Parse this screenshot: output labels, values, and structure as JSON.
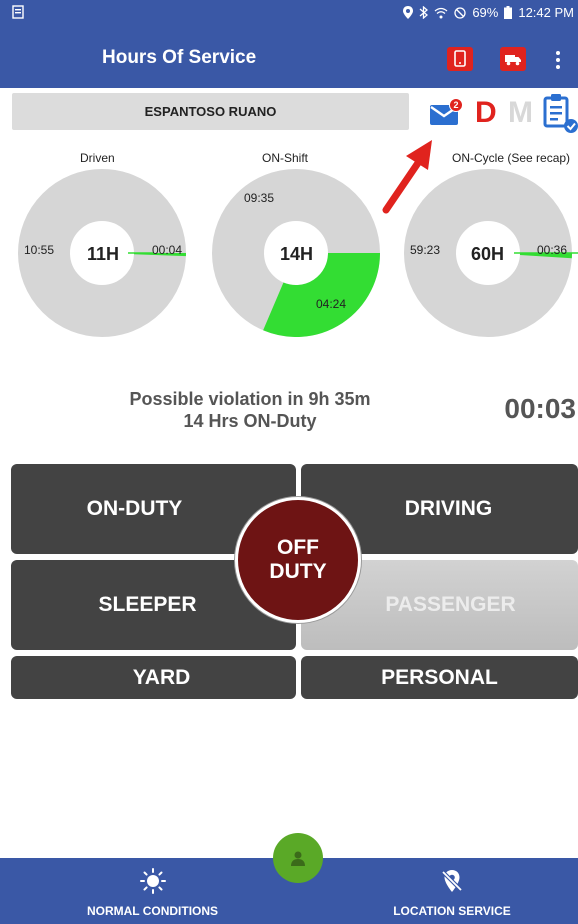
{
  "status_bar": {
    "battery": "69%",
    "time": "12:42 PM"
  },
  "app_bar": {
    "title": "Hours Of Service",
    "icons": [
      "phone-icon",
      "truck-icon",
      "more-vert-icon"
    ]
  },
  "driver": {
    "name": "ESPANTOSO RUANO",
    "mail_badge": "2",
    "letter_d": "D",
    "letter_m": "M"
  },
  "gauges": {
    "driven": {
      "label": "Driven",
      "center": "11H",
      "remaining": "10:55",
      "used": "00:04",
      "used_fraction": 0.006
    },
    "on_shift": {
      "label": "ON-Shift",
      "center": "14H",
      "remaining": "09:35",
      "used": "04:24",
      "used_fraction": 0.314
    },
    "on_cycle": {
      "label": "ON-Cycle (See recap)",
      "center": "60H",
      "remaining": "59:23",
      "used": "00:36",
      "used_fraction": 0.01
    }
  },
  "violation": {
    "line1": "Possible violation in 9h 35m",
    "line2": "14 Hrs ON-Duty",
    "timer": "00:03"
  },
  "status_buttons": {
    "on_duty": "ON-DUTY",
    "driving": "DRIVING",
    "sleeper": "SLEEPER",
    "passenger": "PASSENGER",
    "yard": "YARD",
    "personal": "PERSONAL",
    "off_duty_line1": "OFF",
    "off_duty_line2": "DUTY"
  },
  "bottom_bar": {
    "left_label": "NORMAL CONDITIONS",
    "right_label": "LOCATION SERVICE"
  },
  "colors": {
    "primary": "#3a58a6",
    "red": "#e0231e",
    "green": "#33dd33",
    "off_duty": "#6e1414",
    "button": "#434343",
    "fab": "#5aa927"
  }
}
